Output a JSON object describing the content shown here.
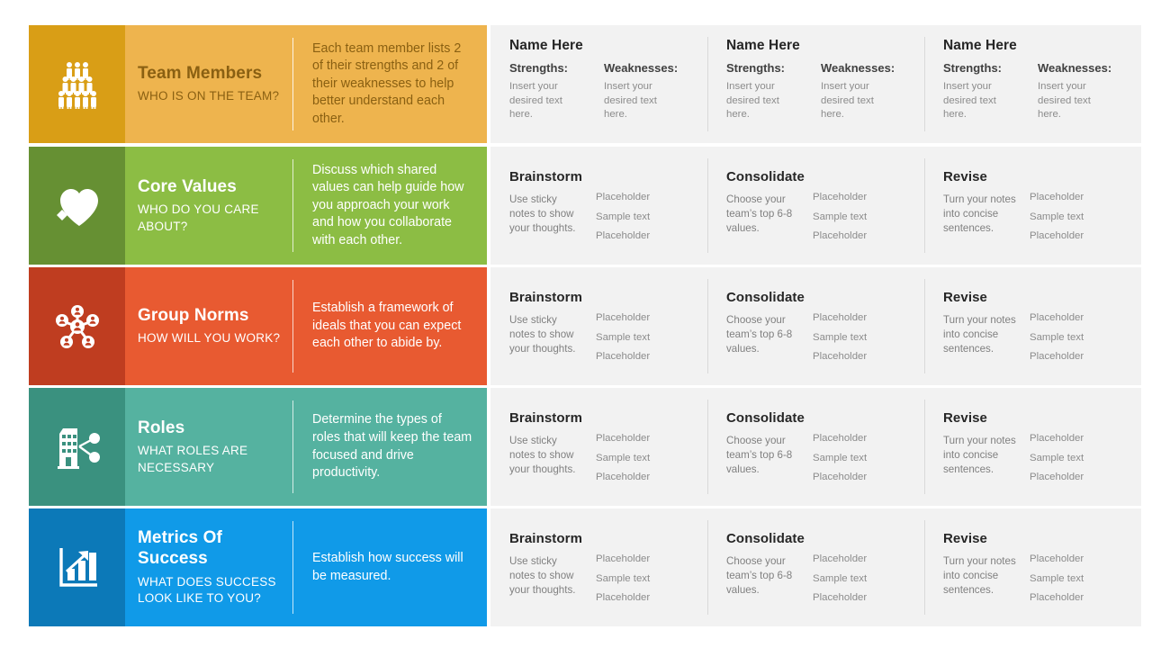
{
  "layout": {
    "rows": 5,
    "panel_background": "#f2f2f2",
    "page_background": "#ffffff"
  },
  "rows": [
    {
      "id": "team-members",
      "icon": "people-pyramid-icon",
      "title": "Team Members",
      "subtitle": "WHO IS ON THE TEAM?",
      "description": "Each team member lists 2 of their strengths and 2 of their weaknesses to help better understand each other.",
      "colors": {
        "icon_bg": "#d99e16",
        "body_bg": "#eeb44e",
        "text": "#8a6012"
      },
      "panel_type": "name-strengths-weaknesses",
      "columns": [
        {
          "name": "Name Here",
          "strengths_label": "Strengths:",
          "strengths_text": "Insert your desired text here.",
          "weaknesses_label": "Weaknesses:",
          "weaknesses_text": "Insert your desired text here."
        },
        {
          "name": "Name Here",
          "strengths_label": "Strengths:",
          "strengths_text": "Insert your desired text here.",
          "weaknesses_label": "Weaknesses:",
          "weaknesses_text": "Insert your desired text here."
        },
        {
          "name": "Name Here",
          "strengths_label": "Strengths:",
          "strengths_text": "Insert your desired text here.",
          "weaknesses_label": "Weaknesses:",
          "weaknesses_text": "Insert your desired text here."
        }
      ]
    },
    {
      "id": "core-values",
      "icon": "heart-sparkle-icon",
      "title": "Core Values",
      "subtitle": "WHO DO YOU CARE ABOUT?",
      "description": "Discuss which shared values can help guide how you approach your work and how you collaborate with each other.",
      "colors": {
        "icon_bg": "#669033",
        "body_bg": "#8cbd44",
        "text": "#ffffff"
      },
      "panel_type": "brainstorm-consolidate-revise",
      "columns": [
        {
          "head": "Brainstorm",
          "text": "Use sticky notes to show your thoughts.",
          "items": [
            "Placeholder",
            "Sample text",
            "Placeholder"
          ]
        },
        {
          "head": "Consolidate",
          "text": "Choose your team’s top 6-8 values.",
          "items": [
            "Placeholder",
            "Sample text",
            "Placeholder"
          ]
        },
        {
          "head": "Revise",
          "text": "Turn your notes into concise sentences.",
          "items": [
            "Placeholder",
            "Sample text",
            "Placeholder"
          ]
        }
      ]
    },
    {
      "id": "group-norms",
      "icon": "network-hub-icon",
      "title": "Group Norms",
      "subtitle": "HOW WILL YOU WORK?",
      "description": "Establish a framework of ideals that you can expect each other to abide by.",
      "colors": {
        "icon_bg": "#bf3d20",
        "body_bg": "#e85a31",
        "text": "#ffffff"
      },
      "panel_type": "brainstorm-consolidate-revise",
      "columns": [
        {
          "head": "Brainstorm",
          "text": "Use sticky notes to show your thoughts.",
          "items": [
            "Placeholder",
            "Sample text",
            "Placeholder"
          ]
        },
        {
          "head": "Consolidate",
          "text": "Choose your team’s top 6-8 values.",
          "items": [
            "Placeholder",
            "Sample text",
            "Placeholder"
          ]
        },
        {
          "head": "Revise",
          "text": "Turn your notes into concise sentences.",
          "items": [
            "Placeholder",
            "Sample text",
            "Placeholder"
          ]
        }
      ]
    },
    {
      "id": "roles",
      "icon": "building-share-icon",
      "title": "Roles",
      "subtitle": "WHAT ROLES ARE NECESSARY",
      "description": "Determine the types of roles that will keep the team focused and drive productivity.",
      "colors": {
        "icon_bg": "#3a917f",
        "body_bg": "#55b2a0",
        "text": "#ffffff"
      },
      "panel_type": "brainstorm-consolidate-revise",
      "columns": [
        {
          "head": "Brainstorm",
          "text": "Use sticky notes to show your thoughts.",
          "items": [
            "Placeholder",
            "Sample text",
            "Placeholder"
          ]
        },
        {
          "head": "Consolidate",
          "text": "Choose your team’s top 6-8 values.",
          "items": [
            "Placeholder",
            "Sample text",
            "Placeholder"
          ]
        },
        {
          "head": "Revise",
          "text": "Turn your notes into concise sentences.",
          "items": [
            "Placeholder",
            "Sample text",
            "Placeholder"
          ]
        }
      ]
    },
    {
      "id": "metrics-of-success",
      "icon": "bar-chart-arrow-icon",
      "title": "Metrics Of Success",
      "subtitle": "WHAT DOES SUCCESS LOOK LIKE TO YOU?",
      "description": "Establish how success will be measured.",
      "colors": {
        "icon_bg": "#0c79b8",
        "body_bg": "#109ae8",
        "text": "#ffffff"
      },
      "panel_type": "brainstorm-consolidate-revise",
      "columns": [
        {
          "head": "Brainstorm",
          "text": "Use sticky notes to show your thoughts.",
          "items": [
            "Placeholder",
            "Sample text",
            "Placeholder"
          ]
        },
        {
          "head": "Consolidate",
          "text": "Choose your team’s top 6-8 values.",
          "items": [
            "Placeholder",
            "Sample text",
            "Placeholder"
          ]
        },
        {
          "head": "Revise",
          "text": "Turn your notes into concise sentences.",
          "items": [
            "Placeholder",
            "Sample text",
            "Placeholder"
          ]
        }
      ]
    }
  ]
}
